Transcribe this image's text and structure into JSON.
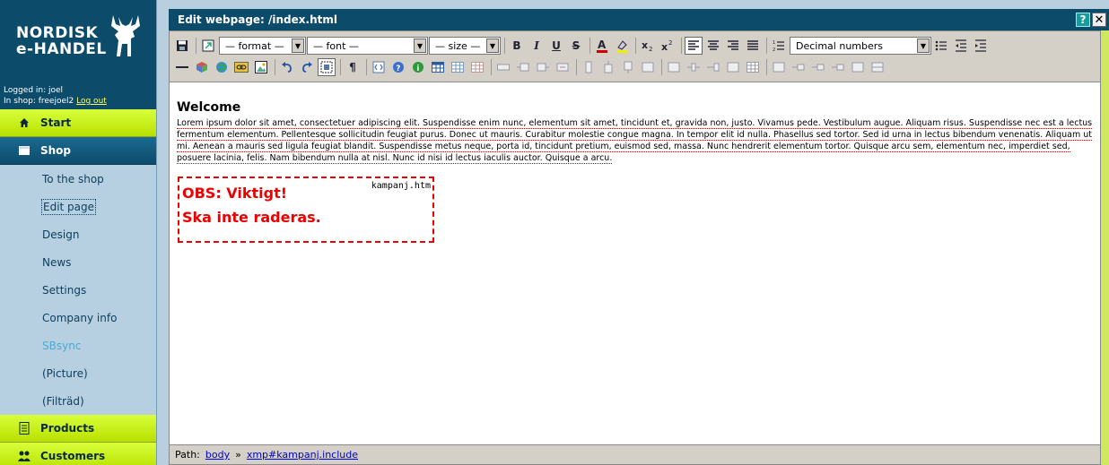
{
  "brand": {
    "line1": "NORDISK",
    "line2": "e-HANDEL"
  },
  "user": {
    "logged_in_text": "Logged in: joel",
    "shop_text": "In shop: freejoel2",
    "logout_label": "Log out"
  },
  "nav": {
    "start": "Start",
    "shop": "Shop",
    "sub_items": [
      "To the shop",
      "Edit page",
      "Design",
      "News",
      "Settings",
      "Company info",
      "SBsync",
      "(Picture)",
      "(Filträd)"
    ],
    "products": "Products",
    "customers": "Customers"
  },
  "window": {
    "title": "Edit webpage: /index.html",
    "help_label": "?",
    "close_label": "✕"
  },
  "toolbar": {
    "format_select": "— format —",
    "font_select": "— font —",
    "size_select": "— size —",
    "list_select": "Decimal numbers",
    "bold": "B",
    "italic": "I",
    "underline": "U",
    "strike": "S"
  },
  "document": {
    "heading": "Welcome",
    "paragraph": "Lorem ipsum dolor sit amet, consectetuer adipiscing elit. Suspendisse enim nunc, elementum sit amet, tincidunt et, gravida non, justo. Vivamus pede. Vestibulum augue. Aliquam risus. Suspendisse nec est a lectus fermentum elementum. Pellentesque sollicitudin feugiat purus. Donec ut mauris. Curabitur molestie congue magna. In tempor elit id nulla. Phasellus sed tortor. Sed id urna in lectus bibendum venenatis. Aliquam ut mi. Aenean a mauris sed ligula feugiat blandit. Suspendisse metus neque, porta id, tincidunt pretium, euismod sed, massa. Nunc hendrerit elementum tortor. Quisque arcu sem, elementum nec, imperdiet sed, posuere lacinia, felis. Nam bibendum nulla at nisl. Nunc id nisi id lectus iaculis auctor. Quisque a arcu.",
    "include": {
      "filename": "kampanj.htm",
      "line1": "OBS: Viktigt!",
      "line2": "Ska inte raderas."
    }
  },
  "statusbar": {
    "label": "Path:",
    "crumb1": "body",
    "separator": "»",
    "crumb2": "xmp#kampanj.include"
  },
  "colors": {
    "header_bg": "#0d4b6b",
    "nav_green": "#c8f000",
    "sidebar_bg": "#b6d0e2",
    "include_border": "#e00000"
  }
}
